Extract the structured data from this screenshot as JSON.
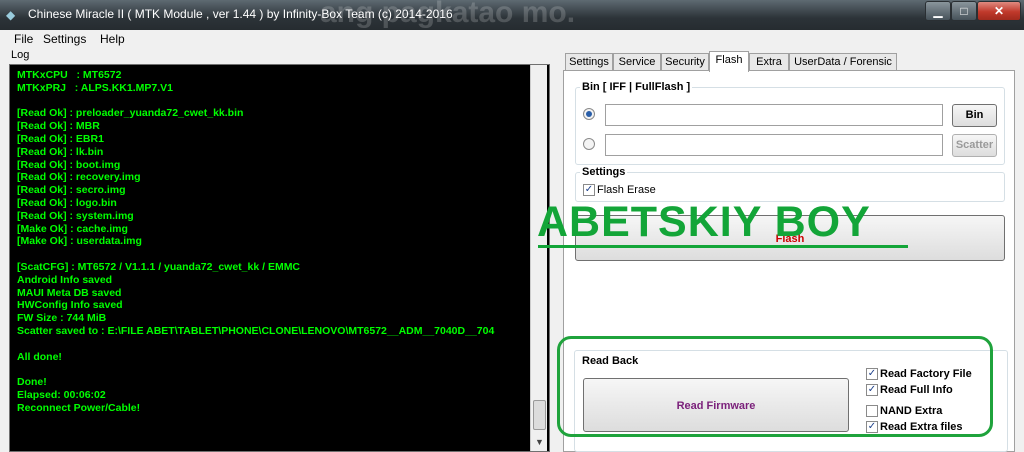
{
  "window": {
    "title": "Chinese Miracle II ( MTK Module , ver 1.44 ) by Infinity-Box Team (c) 2014-2016",
    "background_text": "ang pagkatao mo.",
    "minimize_glyph": "▁",
    "maximize_glyph": "□",
    "close_glyph": "✕"
  },
  "menu": {
    "file": "File",
    "settings": "Settings",
    "help": "Help"
  },
  "log": {
    "label": "Log",
    "lines": [
      "MTKxCPU   : MT6572",
      "MTKxPRJ   : ALPS.KK1.MP7.V1",
      "",
      "[Read Ok] : preloader_yuanda72_cwet_kk.bin",
      "[Read Ok] : MBR",
      "[Read Ok] : EBR1",
      "[Read Ok] : lk.bin",
      "[Read Ok] : boot.img",
      "[Read Ok] : recovery.img",
      "[Read Ok] : secro.img",
      "[Read Ok] : logo.bin",
      "[Read Ok] : system.img",
      "[Make Ok] : cache.img",
      "[Make Ok] : userdata.img",
      "",
      "[ScatCFG] : MT6572 / V1.1.1 / yuanda72_cwet_kk / EMMC",
      "Android Info saved",
      "MAUI Meta DB saved",
      "HWConfig Info saved",
      "FW Size : 744 MiB",
      "Scatter saved to : E:\\FILE ABET\\TABLET\\PHONE\\CLONE\\LENOVO\\MT6572__ADM__7040D__704",
      "",
      "All done!",
      "",
      "Done!",
      "Elapsed: 00:06:02",
      "Reconnect Power/Cable!"
    ]
  },
  "tabs": [
    "Settings",
    "Service",
    "Security",
    "Flash",
    "Extra",
    "UserData / Forensic"
  ],
  "active_tab": "Flash",
  "bin_group": {
    "title": "Bin  [ IFF | FullFlash ]",
    "bin_button": "Bin",
    "scatter_button": "Scatter",
    "bin_path": "",
    "scatter_path": ""
  },
  "settings_group": {
    "title": "Settings",
    "flash_erase": "Flash Erase",
    "flash_erase_checked": true
  },
  "flash_button": "Flash",
  "watermark": "ABETSKIY BOY",
  "read_back": {
    "title": "Read Back",
    "read_firmware_button": "Read Firmware",
    "options": [
      {
        "label": "Read Factory File",
        "checked": true
      },
      {
        "label": "Read Full Info",
        "checked": true
      },
      {
        "label": "NAND Extra",
        "checked": false
      },
      {
        "label": "Read Extra files",
        "checked": true
      }
    ]
  },
  "colors": {
    "log_text": "#00ff00",
    "log_bg": "#000000",
    "watermark": "#13a538",
    "flash_text": "#cc0000",
    "read_firmware_text": "#7a1f7a"
  },
  "icons": {
    "app": "infinity-box-icon",
    "check": "✓"
  }
}
